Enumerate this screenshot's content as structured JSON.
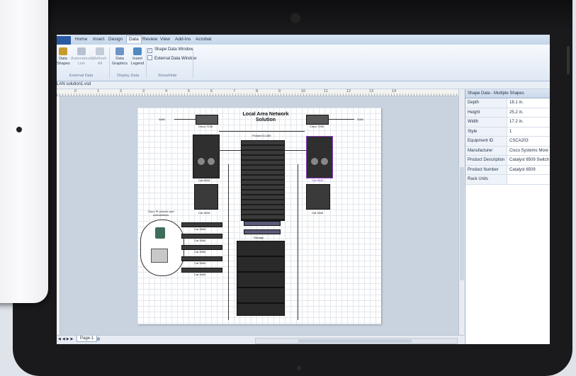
{
  "ribbon": {
    "tabs": [
      "Home",
      "Insert",
      "Design",
      "Data",
      "Review",
      "View",
      "Add-Ins",
      "Acrobat"
    ],
    "active_tab": "Data",
    "buttons": {
      "data_shapes": "Data Shapes",
      "auto_link": "Automatically Link",
      "refresh_all": "Refresh All",
      "data_graphics": "Data Graphics",
      "insert_legend": "Insert Legend"
    },
    "checkboxes": {
      "shape_data_window": "Shape Data Window",
      "external_data_window": "External Data Window"
    },
    "groups": {
      "external_data": "External Data",
      "display_data": "Display Data",
      "show_hide": "Show/Hide"
    }
  },
  "document": {
    "filename": "LAN solution1.vsd"
  },
  "ruler": {
    "numbers": [
      "0",
      "1",
      "2",
      "3",
      "4",
      "5",
      "6",
      "7",
      "8",
      "9",
      "10",
      "11",
      "12",
      "13",
      "14"
    ]
  },
  "diagram": {
    "title_line1": "Local Area Network",
    "title_line2": "Solution",
    "wan_left": "WAN",
    "wan_right": "WAN",
    "router_left": "Cisco 7206",
    "router_right": "Cisco 7206",
    "server_rack": "Proliant DL380",
    "switch_left": "Cat 6509",
    "switch_right": "Cat 6509",
    "switch_left_lower": "Cat 4506",
    "switch_right_lower": "Cat 4506",
    "phones_label": "Cisco IP phones and workstations",
    "cat3560_labels": [
      "Cat 3560",
      "Cat 3560",
      "Cat 3560",
      "Cat 3560",
      "Cat 3560"
    ],
    "storage_label": "Storage"
  },
  "status": {
    "page_tab": "Page-1"
  },
  "shape_data": {
    "title": "Shape Data - Multiple Shapes",
    "rows": [
      {
        "key": "Depth",
        "value": "18.1 in."
      },
      {
        "key": "Height",
        "value": "25.2 in."
      },
      {
        "key": "Width",
        "value": "17.2 in."
      },
      {
        "key": "Style",
        "value": "1"
      },
      {
        "key": "Equipment ID",
        "value": "CSCA203"
      },
      {
        "key": "Manufacturer",
        "value": "Cisco Systems More"
      },
      {
        "key": "Product Description",
        "value": "Catalyst 6509 Switch"
      },
      {
        "key": "Product Number",
        "value": "Catalyst 6509"
      },
      {
        "key": "Rack Units",
        "value": ""
      }
    ]
  },
  "colors": {
    "ribbon_blue": "#2a5aa0",
    "selection": "#8a3cc6",
    "handle": "#3b8ee6"
  }
}
